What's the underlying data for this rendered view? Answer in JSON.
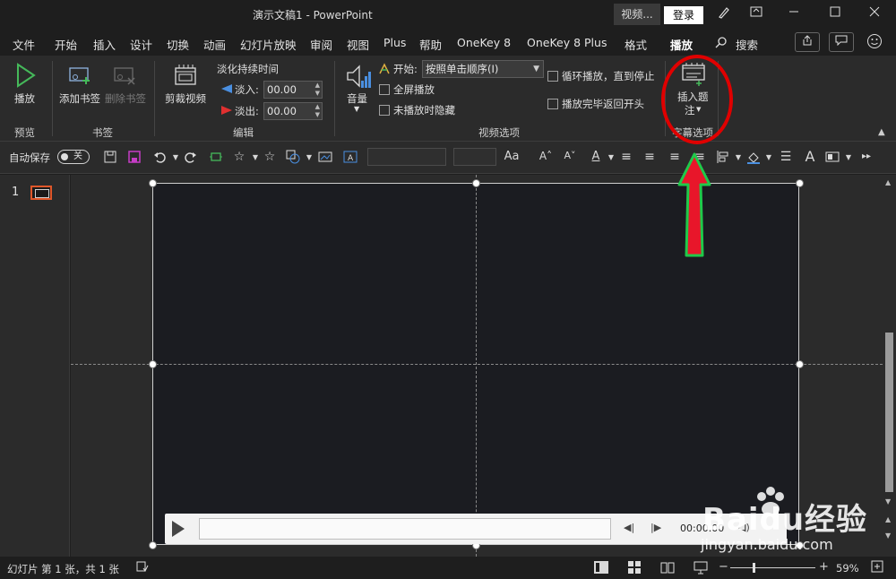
{
  "titlebar": {
    "doc_title": "演示文稿1  -  PowerPoint",
    "video_label": "视频...",
    "login_label": "登录"
  },
  "menu": {
    "tabs": [
      "文件",
      "开始",
      "插入",
      "设计",
      "切换",
      "动画",
      "幻灯片放映",
      "审阅",
      "视图",
      "Plus",
      "帮助",
      "OneKey 8",
      "OneKey 8 Plus",
      "格式",
      "播放",
      "搜索"
    ],
    "active_tab": "播放"
  },
  "ribbon": {
    "preview": {
      "play_label": "播放",
      "group_label": "预览"
    },
    "bookmarks": {
      "add_label": "添加书签",
      "remove_label": "删除书签",
      "group_label": "书签"
    },
    "edit": {
      "trim_label": "剪裁视频",
      "fade_title": "淡化持续时间",
      "fade_in_label": "淡入:",
      "fade_in_value": "00.00",
      "fade_out_label": "淡出:",
      "fade_out_value": "00.00",
      "group_label": "编辑"
    },
    "video_options": {
      "volume_label": "音量",
      "start_label": "开始:",
      "start_value": "按照单击顺序(I)",
      "fullscreen_label": "全屏播放",
      "hide_label": "未播放时隐藏",
      "loop_label": "循环播放，直到停止",
      "rewind_label": "播放完毕返回开头",
      "group_label": "视频选项"
    },
    "captions": {
      "insert_label_1": "插入题",
      "insert_label_2": "注",
      "group_label": "字幕选项"
    }
  },
  "qat": {
    "autosave_label": "自动保存",
    "toggle_label": "关"
  },
  "slides": {
    "current_number": "1"
  },
  "player": {
    "time": "00:00.00"
  },
  "statusbar": {
    "slide_info": "幻灯片 第 1 张，共 1 张",
    "zoom": "59%"
  },
  "watermark": {
    "brand": "Baidu经验",
    "url": "jingyan.baidu.com"
  },
  "colors": {
    "annotation_red": "#e00000",
    "arrow_fill": "#e8162a",
    "arrow_stroke": "#1fc94a",
    "play_icon": "#45b95a"
  }
}
